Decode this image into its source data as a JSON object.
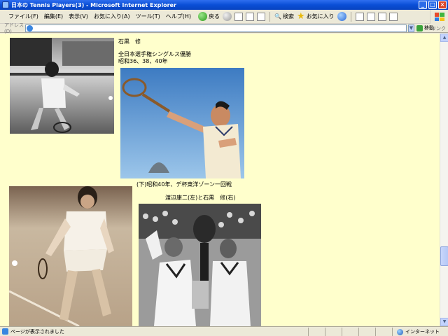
{
  "window": {
    "title": "日本の Tennis Players(3) - Microsoft Internet Explorer",
    "controls": [
      "_",
      "□",
      "×"
    ]
  },
  "menu": {
    "items": [
      "ファイル(F)",
      "編集(E)",
      "表示(V)",
      "お気に入り(A)",
      "ツール(T)",
      "ヘルプ(H)"
    ]
  },
  "toolbar": {
    "back_label": "戻る",
    "search_label": "検索",
    "favorites_label": "お気に入り"
  },
  "address": {
    "label": "アドレス(D)",
    "url": "",
    "go_label": "移動",
    "links_label": "リンク"
  },
  "article": {
    "player_name": "石黒　修",
    "title_line": "全日本選手権シングルス優勝",
    "years_line": "昭和36、38、40年",
    "caption_lower": "(下)昭和40年、デ杯東洋ゾーン一回戦",
    "caption_pair": "渡辺康二(左)と石黒　修(右)"
  },
  "status": {
    "text": "ページが表示されました",
    "zone": "インターネット"
  },
  "colors": {
    "page_background": "#ffffcc",
    "titlebar": "#0a4fd6"
  }
}
